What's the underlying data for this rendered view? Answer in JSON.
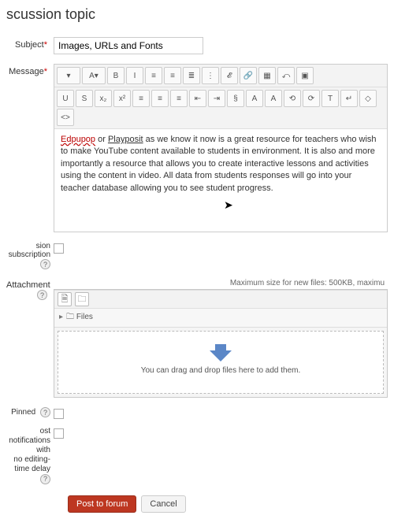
{
  "page_title": "scussion topic",
  "subject": {
    "label": "Subject",
    "value": "Images, URLs and Fonts"
  },
  "message": {
    "label": "Message",
    "body_parts": {
      "w1": "Edpupop",
      "w2": " or ",
      "w3": "Playposit",
      "rest": " as we know it now is a great resource for teachers who wish to make YouTube content available to students in environment. It is also and more importantly a resource that allows you to create interactive lessons and activities using the content in video. All data from students responses will go into your teacher database allowing you to see student progress."
    }
  },
  "toolbar1": {
    "i0": "▾",
    "i1": "A▾",
    "i2": "B",
    "i3": "I",
    "i4": "≡",
    "i5": "≡",
    "i6": "≣",
    "i7": "⋮",
    "i8": "𝓔",
    "i9": "🔗",
    "i10": "▦",
    "i11": "⤺",
    "i12": "▣"
  },
  "toolbar2": {
    "i0": "U",
    "i1": "S",
    "i2": "x₂",
    "i3": "x²",
    "i4": "≡",
    "i5": "≡",
    "i6": "≡",
    "i7": "⇤",
    "i8": "⇥",
    "i9": "§",
    "i10": "A",
    "i11": "A",
    "i12": "⟲",
    "i13": "⟳",
    "i14": "T",
    "i15": "↵",
    "i16": "◇",
    "i17": "<>"
  },
  "subscription": {
    "label": "sion subscription"
  },
  "attachment": {
    "label": "Attachment",
    "hint": "Maximum size for new files: 500KB, maximu",
    "files_label": "Files",
    "drop_text": "You can drag and drop files here to add them."
  },
  "pinned": {
    "label": "Pinned"
  },
  "notify": {
    "label1": "ost notifications with",
    "label2": "no editing-time delay"
  },
  "buttons": {
    "submit": "Post to forum",
    "cancel": "Cancel"
  },
  "help": "?"
}
